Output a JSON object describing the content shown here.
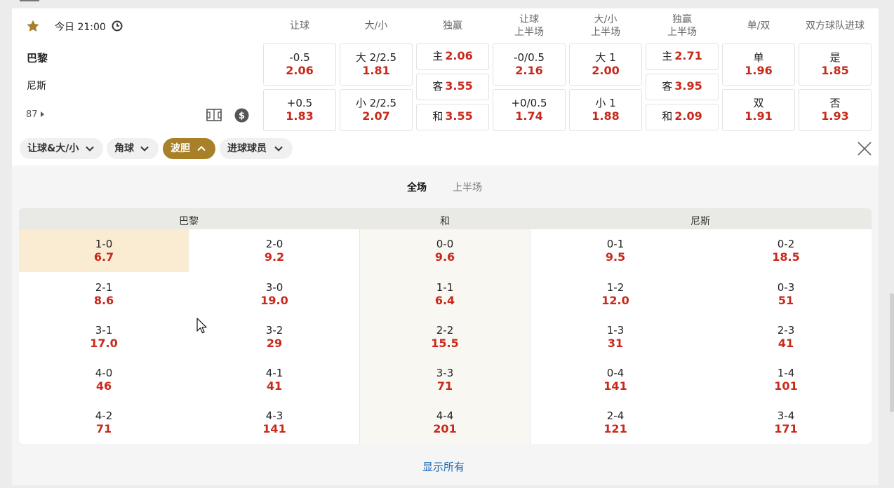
{
  "match": {
    "time": "今日 21:00",
    "home": "巴黎",
    "away": "尼斯",
    "more_count": "87"
  },
  "columns": [
    {
      "l1": "让球",
      "l2": ""
    },
    {
      "l1": "大/小",
      "l2": ""
    },
    {
      "l1": "独赢",
      "l2": ""
    },
    {
      "l1": "让球",
      "l2": "上半场"
    },
    {
      "l1": "大/小",
      "l2": "上半场"
    },
    {
      "l1": "独赢",
      "l2": "上半场"
    },
    {
      "l1": "单/双",
      "l2": ""
    },
    {
      "l1": "双方球队进球",
      "l2": ""
    }
  ],
  "odds": {
    "hdp": [
      {
        "label": "-0.5",
        "odd": "2.06"
      },
      {
        "label": "+0.5",
        "odd": "1.83"
      }
    ],
    "ou": [
      {
        "label": "大 2/2.5",
        "odd": "1.81"
      },
      {
        "label": "小 2/2.5",
        "odd": "2.07"
      }
    ],
    "x12": [
      {
        "label": "主",
        "odd": "2.06"
      },
      {
        "label": "客",
        "odd": "3.55"
      },
      {
        "label": "和",
        "odd": "3.55"
      }
    ],
    "hdp_h": [
      {
        "label": "-0/0.5",
        "odd": "2.16"
      },
      {
        "label": "+0/0.5",
        "odd": "1.74"
      }
    ],
    "ou_h": [
      {
        "label": "大 1",
        "odd": "2.00"
      },
      {
        "label": "小 1",
        "odd": "1.88"
      }
    ],
    "x12_h": [
      {
        "label": "主",
        "odd": "2.71"
      },
      {
        "label": "客",
        "odd": "3.95"
      },
      {
        "label": "和",
        "odd": "2.09"
      }
    ],
    "oe": [
      {
        "label": "单",
        "odd": "1.96"
      },
      {
        "label": "双",
        "odd": "1.91"
      }
    ],
    "btts": [
      {
        "label": "是",
        "odd": "1.85"
      },
      {
        "label": "否",
        "odd": "1.93"
      }
    ]
  },
  "chips": [
    "让球&大/小",
    "角球",
    "波胆",
    "进球球员"
  ],
  "tabs": [
    "全场",
    "上半场"
  ],
  "grid_head": {
    "home": "巴黎",
    "draw": "和",
    "away": "尼斯"
  },
  "home_col1": [
    {
      "score": "1-0",
      "odd": "6.7"
    },
    {
      "score": "2-1",
      "odd": "8.6"
    },
    {
      "score": "3-1",
      "odd": "17.0"
    },
    {
      "score": "4-0",
      "odd": "46"
    },
    {
      "score": "4-2",
      "odd": "71"
    }
  ],
  "home_col2": [
    {
      "score": "2-0",
      "odd": "9.2"
    },
    {
      "score": "3-0",
      "odd": "19.0"
    },
    {
      "score": "3-2",
      "odd": "29"
    },
    {
      "score": "4-1",
      "odd": "41"
    },
    {
      "score": "4-3",
      "odd": "141"
    }
  ],
  "draw_col": [
    {
      "score": "0-0",
      "odd": "9.6"
    },
    {
      "score": "1-1",
      "odd": "6.4"
    },
    {
      "score": "2-2",
      "odd": "15.5"
    },
    {
      "score": "3-3",
      "odd": "71"
    },
    {
      "score": "4-4",
      "odd": "201"
    }
  ],
  "away_col1": [
    {
      "score": "0-1",
      "odd": "9.5"
    },
    {
      "score": "1-2",
      "odd": "12.0"
    },
    {
      "score": "1-3",
      "odd": "31"
    },
    {
      "score": "0-4",
      "odd": "141"
    },
    {
      "score": "2-4",
      "odd": "121"
    }
  ],
  "away_col2": [
    {
      "score": "0-2",
      "odd": "18.5"
    },
    {
      "score": "0-3",
      "odd": "51"
    },
    {
      "score": "2-3",
      "odd": "41"
    },
    {
      "score": "1-4",
      "odd": "101"
    },
    {
      "score": "3-4",
      "odd": "171"
    }
  ],
  "show_all": "显示所有",
  "colors": {
    "accent": "#a8802a",
    "odd": "#c8291b",
    "link": "#1b66b3",
    "highlight": "#faecd3"
  }
}
